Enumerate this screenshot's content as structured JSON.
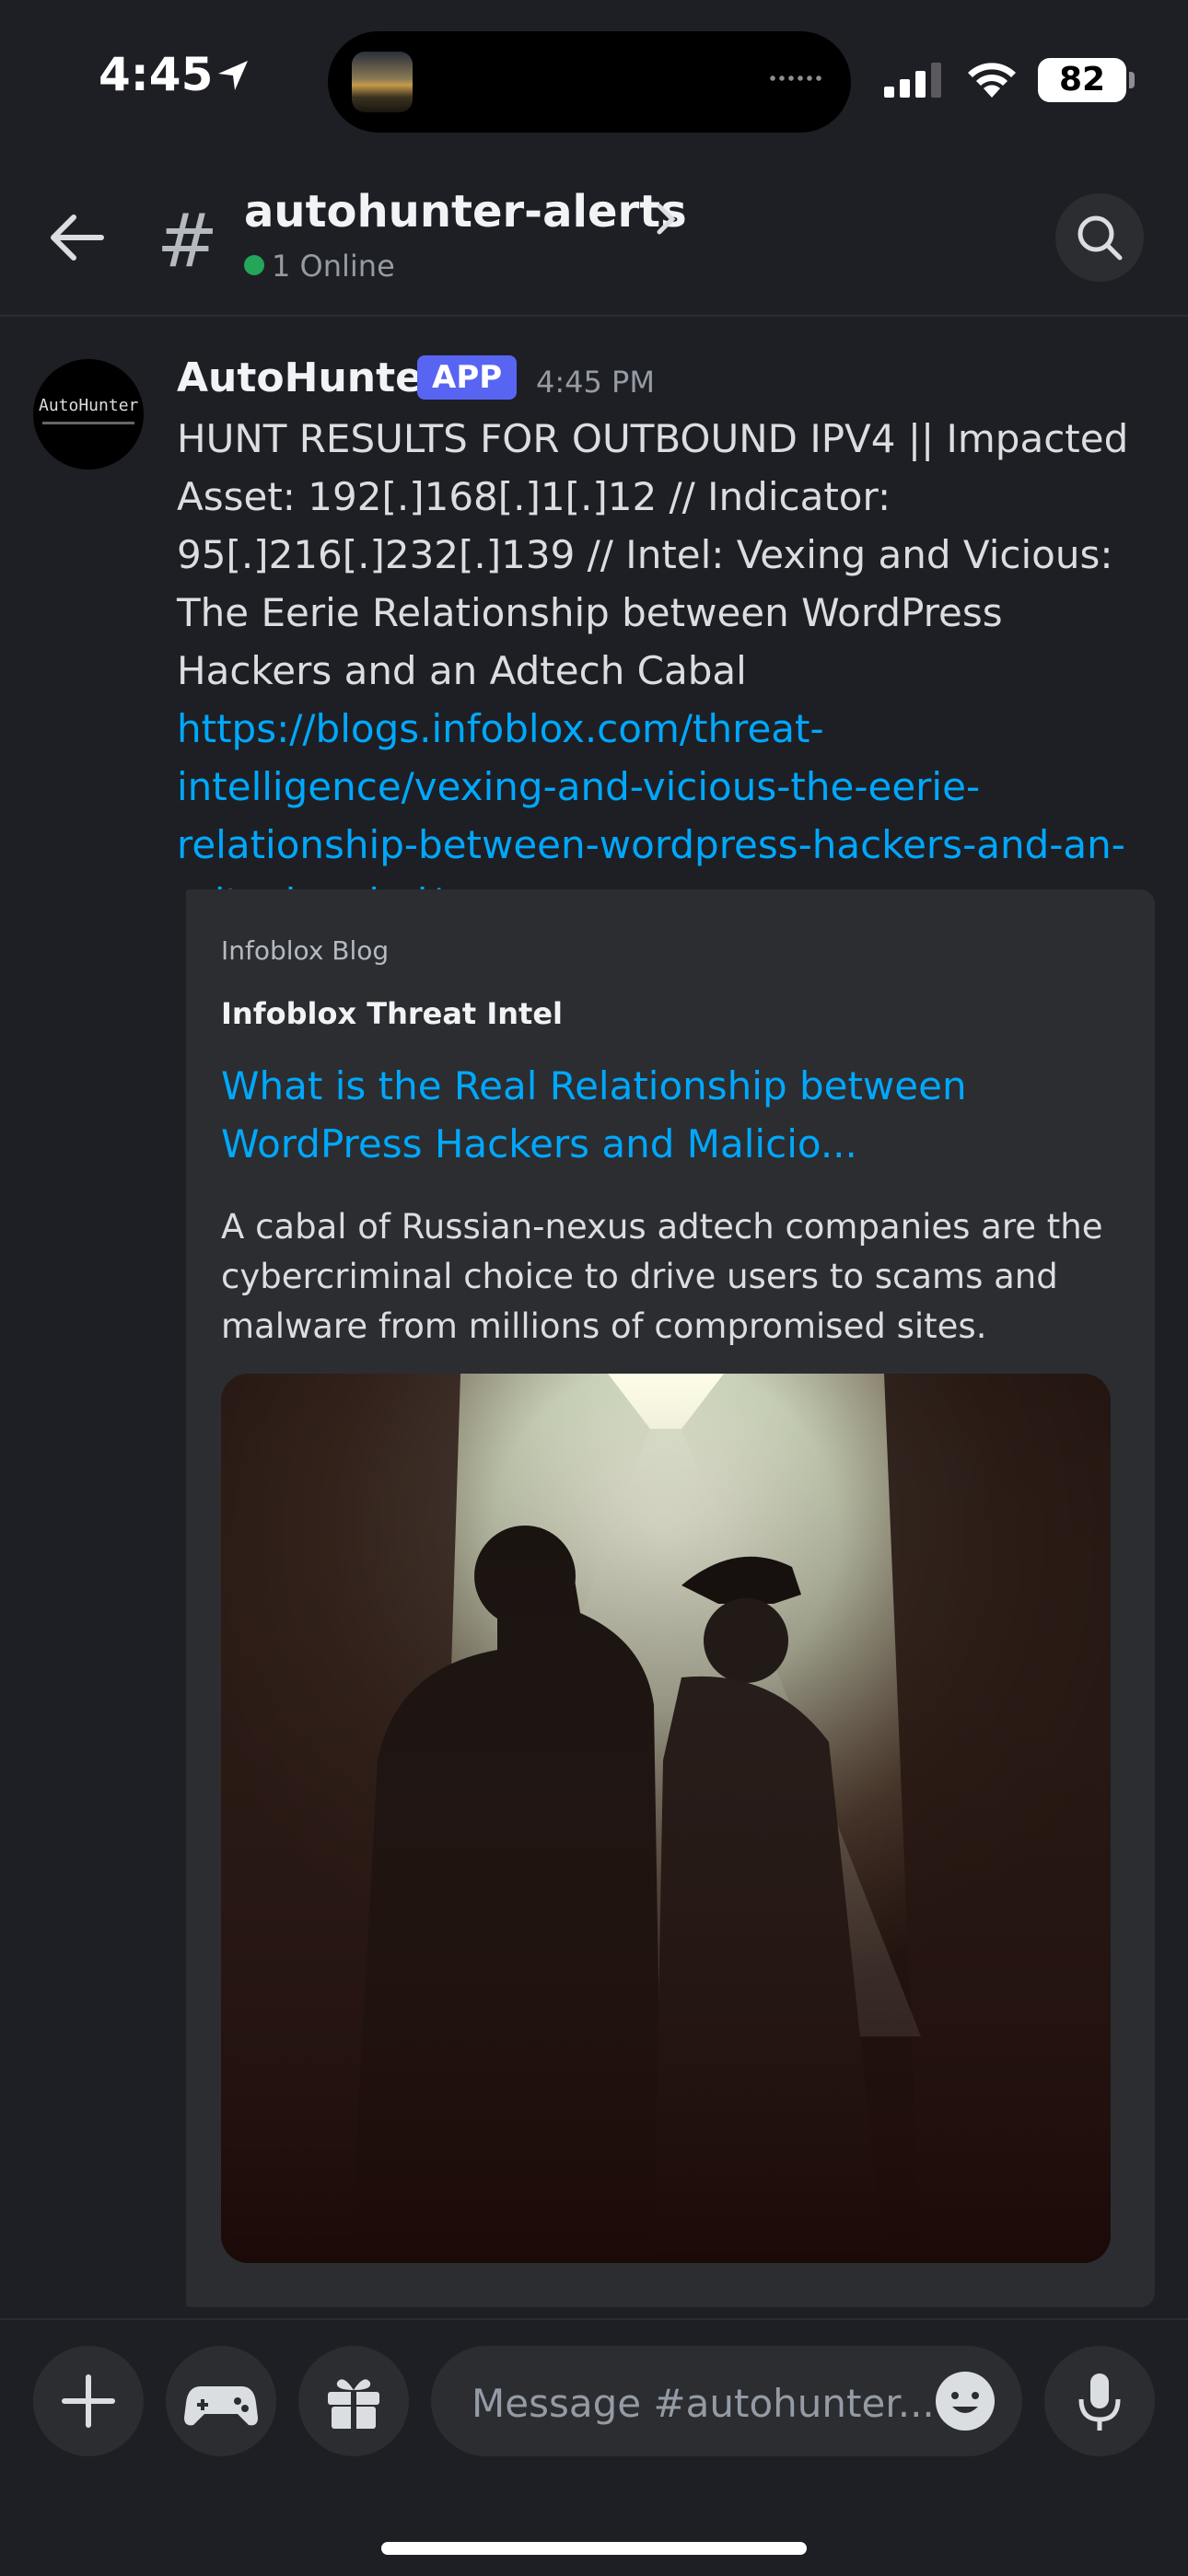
{
  "status_bar": {
    "time": "4:45",
    "battery": "82"
  },
  "header": {
    "channel_name": "autohunter-alerts",
    "online_status": "1 Online"
  },
  "message": {
    "avatar_text": "AutoHunter",
    "author": "AutoHunter",
    "badge": "APP",
    "timestamp": "4:45 PM",
    "body": "HUNT RESULTS FOR OUTBOUND IPV4 || Impacted Asset: 192[.]168[.]1[.]12 // Indicator: 95[.]216[.]232[.]139 // Intel: Vexing and Vicious: The Eerie Relationship between WordPress Hackers and an Adtech Cabal ",
    "link": "https://blogs.infoblox.com/threat-intelligence/vexing-and-vicious-the-eerie-relationship-between-wordpress-hackers-and-an-adtech-cabal/"
  },
  "embed": {
    "provider": "Infoblox Blog",
    "author": "Infoblox Threat Intel",
    "title": "What is the Real Relationship between WordPress Hackers and Malicio...",
    "description": "A cabal of Russian-nexus adtech companies are the cybercriminal choice to drive users to scams and malware from millions of compromised sites."
  },
  "composer": {
    "placeholder": "Message #autohunter..."
  },
  "icons": [
    "location-arrow-icon",
    "cellular-signal-icon",
    "wifi-icon",
    "back-arrow-icon",
    "hash-icon",
    "chevron-right-icon",
    "search-icon",
    "plus-icon",
    "gamepad-icon",
    "gift-icon",
    "emoji-icon",
    "microphone-icon"
  ],
  "colors": {
    "background": "#1e1f24",
    "link": "#00a8fc",
    "app_badge": "#5865f2",
    "online": "#23a55a"
  }
}
